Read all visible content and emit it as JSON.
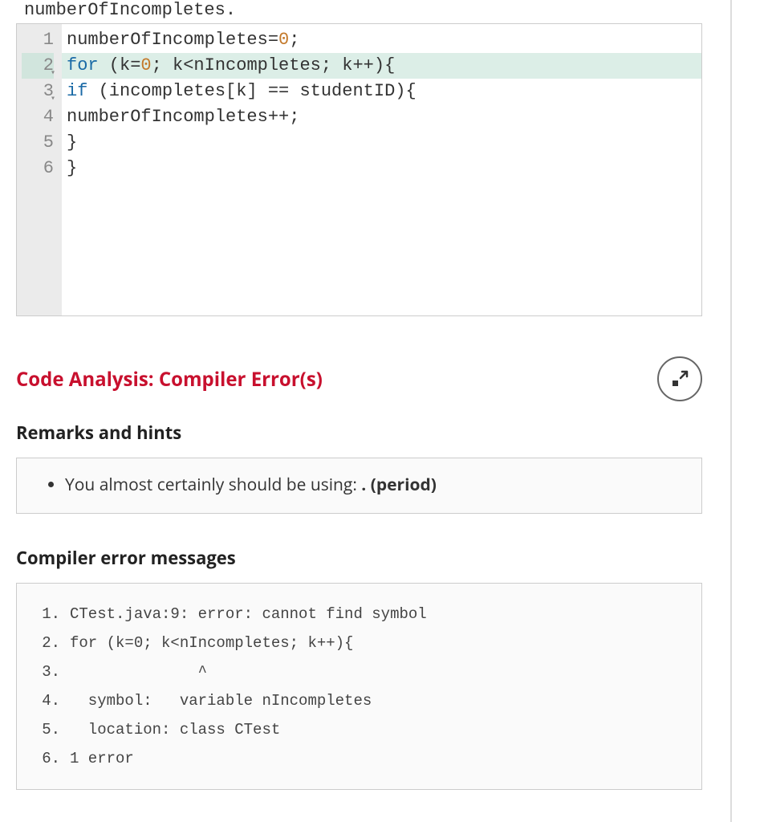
{
  "header_text": "numberOfIncompletes.",
  "code": {
    "lines": [
      {
        "n": "1",
        "has_fold": false,
        "segments": [
          {
            "t": "numberOfIncompletes=",
            "c": "id"
          },
          {
            "t": "0",
            "c": "num"
          },
          {
            "t": ";",
            "c": "op"
          }
        ]
      },
      {
        "n": "2",
        "has_fold": true,
        "highlighted": true,
        "segments": [
          {
            "t": "for",
            "c": "kw"
          },
          {
            "t": " (k=",
            "c": "id"
          },
          {
            "t": "0",
            "c": "num"
          },
          {
            "t": "; k<nIncompletes; k++){",
            "c": "id"
          }
        ]
      },
      {
        "n": "3",
        "has_fold": true,
        "segments": [
          {
            "t": "if",
            "c": "kw"
          },
          {
            "t": " (incompletes[k] == studentID){",
            "c": "id"
          }
        ]
      },
      {
        "n": "4",
        "has_fold": false,
        "segments": [
          {
            "t": "numberOfIncompletes++;",
            "c": "id"
          }
        ]
      },
      {
        "n": "5",
        "has_fold": false,
        "segments": [
          {
            "t": "}",
            "c": "id"
          }
        ]
      },
      {
        "n": "6",
        "has_fold": false,
        "segments": [
          {
            "t": "}",
            "c": "id"
          }
        ]
      }
    ]
  },
  "analysis_title": "Code Analysis: Compiler Error(s)",
  "remarks_title": "Remarks and hints",
  "hint_prefix": "You almost certainly should be using: ",
  "hint_bold": ". (period)",
  "compiler_title": "Compiler error messages",
  "errors": [
    {
      "n": "1.",
      "text": "CTest.java:9: error: cannot find symbol"
    },
    {
      "n": "2.",
      "text": "for (k=0; k<nIncompletes; k++){"
    },
    {
      "n": "3.",
      "text": "              ^"
    },
    {
      "n": "4.",
      "text": "  symbol:   variable nIncompletes"
    },
    {
      "n": "5.",
      "text": "  location: class CTest"
    },
    {
      "n": "6.",
      "text": "1 error"
    }
  ]
}
